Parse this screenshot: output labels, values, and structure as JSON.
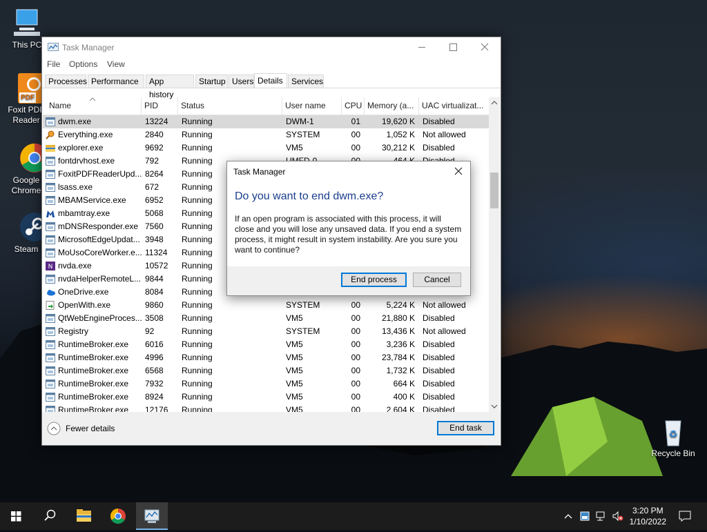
{
  "desktop": {
    "icons": [
      {
        "label": "This PC"
      },
      {
        "label": "Foxit PDF Reader"
      },
      {
        "label": "Google Chrome"
      },
      {
        "label": "Steam"
      },
      {
        "label": "Recycle Bin"
      }
    ],
    "foxit_badge": "PDF"
  },
  "window": {
    "title": "Task Manager",
    "menu": [
      "File",
      "Options",
      "View"
    ],
    "tabs": [
      "Processes",
      "Performance",
      "App history",
      "Startup",
      "Users",
      "Details",
      "Services"
    ],
    "active_tab": "Details",
    "columns": [
      "Name",
      "PID",
      "Status",
      "User name",
      "CPU",
      "Memory (a...",
      "UAC virtualizat..."
    ],
    "rows": [
      {
        "name": "dwm.exe",
        "pid": "13224",
        "status": "Running",
        "user": "DWM-1",
        "cpu": "01",
        "mem": "19,620 K",
        "uac": "Disabled",
        "icon": "window-icon",
        "selected": true
      },
      {
        "name": "Everything.exe",
        "pid": "2840",
        "status": "Running",
        "user": "SYSTEM",
        "cpu": "00",
        "mem": "1,052 K",
        "uac": "Not allowed",
        "icon": "magnifier-icon"
      },
      {
        "name": "explorer.exe",
        "pid": "9692",
        "status": "Running",
        "user": "VM5",
        "cpu": "00",
        "mem": "30,212 K",
        "uac": "Disabled",
        "icon": "folder-icon"
      },
      {
        "name": "fontdrvhost.exe",
        "pid": "792",
        "status": "Running",
        "user": "UMFD-0",
        "cpu": "00",
        "mem": "464 K",
        "uac": "Disabled",
        "icon": "window-icon"
      },
      {
        "name": "FoxitPDFReaderUpd...",
        "pid": "8264",
        "status": "Running",
        "user": "",
        "cpu": "",
        "mem": "",
        "uac": "",
        "icon": "window-icon"
      },
      {
        "name": "lsass.exe",
        "pid": "672",
        "status": "Running",
        "user": "",
        "cpu": "",
        "mem": "",
        "uac": "",
        "icon": "window-icon"
      },
      {
        "name": "MBAMService.exe",
        "pid": "6952",
        "status": "Running",
        "user": "",
        "cpu": "",
        "mem": "",
        "uac": "",
        "icon": "window-icon"
      },
      {
        "name": "mbamtray.exe",
        "pid": "5068",
        "status": "Running",
        "user": "",
        "cpu": "",
        "mem": "",
        "uac": "",
        "icon": "malwarebytes-icon"
      },
      {
        "name": "mDNSResponder.exe",
        "pid": "7560",
        "status": "Running",
        "user": "",
        "cpu": "",
        "mem": "",
        "uac": "",
        "icon": "window-icon"
      },
      {
        "name": "MicrosoftEdgeUpdat...",
        "pid": "3948",
        "status": "Running",
        "user": "",
        "cpu": "",
        "mem": "",
        "uac": "",
        "icon": "window-icon"
      },
      {
        "name": "MoUsoCoreWorker.e...",
        "pid": "11324",
        "status": "Running",
        "user": "",
        "cpu": "",
        "mem": "",
        "uac": "",
        "icon": "window-icon"
      },
      {
        "name": "nvda.exe",
        "pid": "10572",
        "status": "Running",
        "user": "",
        "cpu": "",
        "mem": "",
        "uac": "",
        "icon": "nvda-icon"
      },
      {
        "name": "nvdaHelperRemoteL...",
        "pid": "9844",
        "status": "Running",
        "user": "",
        "cpu": "",
        "mem": "",
        "uac": "",
        "icon": "window-icon"
      },
      {
        "name": "OneDrive.exe",
        "pid": "8084",
        "status": "Running",
        "user": "",
        "cpu": "",
        "mem": "",
        "uac": "",
        "icon": "cloud-icon"
      },
      {
        "name": "OpenWith.exe",
        "pid": "9860",
        "status": "Running",
        "user": "SYSTEM",
        "cpu": "00",
        "mem": "5,224 K",
        "uac": "Not allowed",
        "icon": "openwith-icon"
      },
      {
        "name": "QtWebEngineProces...",
        "pid": "3508",
        "status": "Running",
        "user": "VM5",
        "cpu": "00",
        "mem": "21,880 K",
        "uac": "Disabled",
        "icon": "window-icon"
      },
      {
        "name": "Registry",
        "pid": "92",
        "status": "Running",
        "user": "SYSTEM",
        "cpu": "00",
        "mem": "13,436 K",
        "uac": "Not allowed",
        "icon": "window-icon"
      },
      {
        "name": "RuntimeBroker.exe",
        "pid": "6016",
        "status": "Running",
        "user": "VM5",
        "cpu": "00",
        "mem": "3,236 K",
        "uac": "Disabled",
        "icon": "window-icon"
      },
      {
        "name": "RuntimeBroker.exe",
        "pid": "4996",
        "status": "Running",
        "user": "VM5",
        "cpu": "00",
        "mem": "23,784 K",
        "uac": "Disabled",
        "icon": "window-icon"
      },
      {
        "name": "RuntimeBroker.exe",
        "pid": "6568",
        "status": "Running",
        "user": "VM5",
        "cpu": "00",
        "mem": "1,732 K",
        "uac": "Disabled",
        "icon": "window-icon"
      },
      {
        "name": "RuntimeBroker.exe",
        "pid": "7932",
        "status": "Running",
        "user": "VM5",
        "cpu": "00",
        "mem": "664 K",
        "uac": "Disabled",
        "icon": "window-icon"
      },
      {
        "name": "RuntimeBroker.exe",
        "pid": "8924",
        "status": "Running",
        "user": "VM5",
        "cpu": "00",
        "mem": "400 K",
        "uac": "Disabled",
        "icon": "window-icon"
      },
      {
        "name": "RuntimeBroker.exe",
        "pid": "12176",
        "status": "Running",
        "user": "VM5",
        "cpu": "00",
        "mem": "2,604 K",
        "uac": "Disabled",
        "icon": "window-icon"
      }
    ],
    "fewer_details": "Fewer details",
    "end_task": "End task"
  },
  "dialog": {
    "title": "Task Manager",
    "heading": "Do you want to end dwm.exe?",
    "message": "If an open program is associated with this process, it will close and you will lose any unsaved data. If you end a system process, it might result in system instability. Are you sure you want to continue?",
    "confirm": "End process",
    "cancel": "Cancel"
  },
  "taskbar": {
    "time": "3:20 PM",
    "date": "1/10/2022"
  },
  "colors": {
    "accent": "#0078d7",
    "heading": "#1a3e8c",
    "selection": "#d9d9d9",
    "taskbar": "#1c1c1c"
  }
}
